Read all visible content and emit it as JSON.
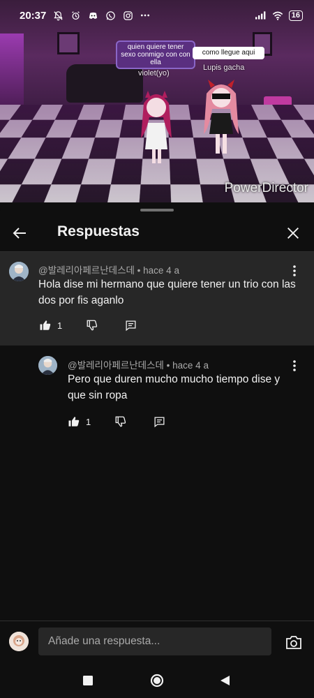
{
  "status_bar": {
    "time": "20:37",
    "battery": "16"
  },
  "video": {
    "bubble_left": "quien quiere tener sexo conmigo con con ella",
    "bubble_right": "como llegue aqui",
    "name_left": "violet(yo)",
    "name_right": "Lupis gacha",
    "watermark": "PowerDirector"
  },
  "header": {
    "title": "Respuestas"
  },
  "main_comment": {
    "author": "@발레리아페르난데스데",
    "age": "hace 4 a",
    "text": "Hola dise mi hermano que quiere tener un trio con las dos por fis aganlo",
    "likes": "1"
  },
  "reply": {
    "author": "@발레리아페르난데스데",
    "age": "hace 4 a",
    "text": "Pero que duren mucho mucho tiempo dise y que sin ropa",
    "likes": "1"
  },
  "reply_input": {
    "placeholder": "Añade una respuesta..."
  },
  "colors": {
    "background": "#0f0f0f",
    "highlight": "#272727",
    "meta": "#aaaaaa",
    "text": "#f1f1f1"
  },
  "icons": [
    "back-arrow-icon",
    "close-icon",
    "thumbs-up-icon",
    "thumbs-down-icon",
    "reply-icon",
    "more-vert-icon",
    "camera-icon",
    "avatar"
  ]
}
